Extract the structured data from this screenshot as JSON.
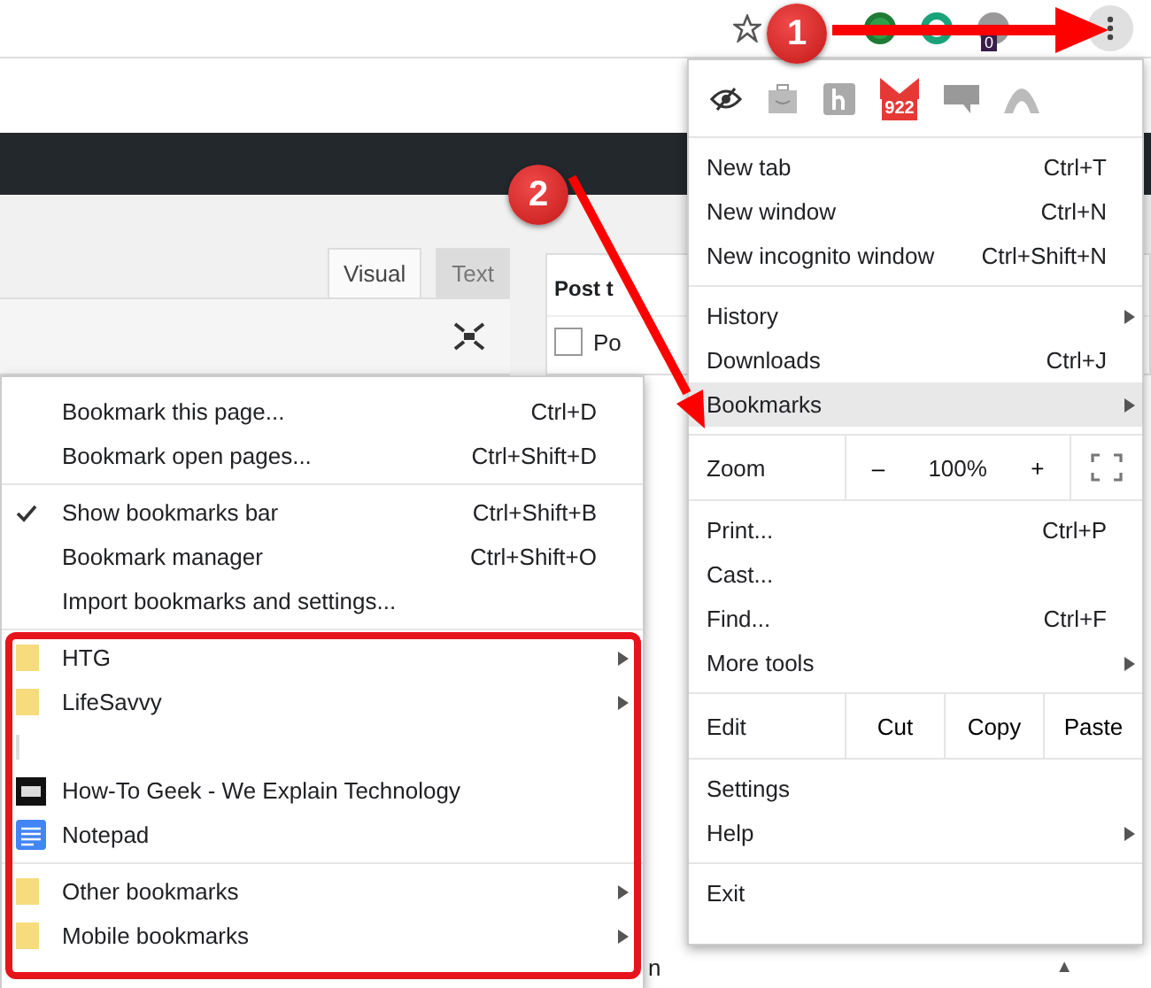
{
  "toolbar": {
    "extension_badge": "0"
  },
  "editor": {
    "tabs": [
      {
        "label": "Visual",
        "selected": true
      },
      {
        "label": "Text",
        "selected": false
      }
    ]
  },
  "side_panel": {
    "title": "Post t",
    "checkbox_label": "Po",
    "checked": false
  },
  "page_footer": {
    "text": "n",
    "arrow": "▲"
  },
  "chrome_menu": {
    "extension_badge": "922",
    "sections": [
      {
        "kind": "items",
        "items": [
          {
            "label": "New tab",
            "shortcut": "Ctrl+T",
            "submenu": false,
            "selected": false
          },
          {
            "label": "New window",
            "shortcut": "Ctrl+N",
            "submenu": false,
            "selected": false
          },
          {
            "label": "New incognito window",
            "shortcut": "Ctrl+Shift+N",
            "submenu": false,
            "selected": false
          }
        ]
      },
      {
        "kind": "items",
        "items": [
          {
            "label": "History",
            "submenu": true,
            "selected": false
          },
          {
            "label": "Downloads",
            "shortcut": "Ctrl+J",
            "submenu": false,
            "selected": false
          },
          {
            "label": "Bookmarks",
            "submenu": true,
            "selected": true
          }
        ]
      },
      {
        "kind": "zoom",
        "label": "Zoom",
        "minus": "–",
        "value": "100%",
        "plus": "+"
      },
      {
        "kind": "items",
        "items": [
          {
            "label": "Print...",
            "shortcut": "Ctrl+P",
            "submenu": false,
            "selected": false
          },
          {
            "label": "Cast...",
            "submenu": false,
            "selected": false
          },
          {
            "label": "Find...",
            "shortcut": "Ctrl+F",
            "submenu": false,
            "selected": false
          },
          {
            "label": "More tools",
            "submenu": true,
            "selected": false
          }
        ]
      },
      {
        "kind": "edit",
        "label": "Edit",
        "buttons": [
          "Cut",
          "Copy",
          "Paste"
        ]
      },
      {
        "kind": "items",
        "items": [
          {
            "label": "Settings",
            "submenu": false,
            "selected": false
          },
          {
            "label": "Help",
            "submenu": true,
            "selected": false
          }
        ]
      },
      {
        "kind": "items",
        "items": [
          {
            "label": "Exit",
            "submenu": false,
            "selected": false
          }
        ]
      }
    ]
  },
  "bookmarks_menu": {
    "sections": [
      {
        "items": [
          {
            "kind": "action",
            "label": "Bookmark this page...",
            "shortcut": "Ctrl+D"
          },
          {
            "kind": "action",
            "label": "Bookmark open pages...",
            "shortcut": "Ctrl+Shift+D"
          }
        ]
      },
      {
        "items": [
          {
            "kind": "action",
            "label": "Show bookmarks bar",
            "shortcut": "Ctrl+Shift+B",
            "checked": true
          },
          {
            "kind": "action",
            "label": "Bookmark manager",
            "shortcut": "Ctrl+Shift+O",
            "checked": false
          },
          {
            "kind": "action",
            "label": "Import bookmarks and settings...",
            "checked": false
          }
        ]
      },
      {
        "items": [
          {
            "kind": "folder",
            "label": "HTG"
          },
          {
            "kind": "folder",
            "label": "LifeSavvy"
          },
          {
            "kind": "blank"
          },
          {
            "kind": "site",
            "label": "How-To Geek - We Explain Technology"
          },
          {
            "kind": "document",
            "label": "Notepad"
          }
        ]
      },
      {
        "items": [
          {
            "kind": "folder",
            "label": "Other bookmarks"
          },
          {
            "kind": "folder",
            "label": "Mobile bookmarks"
          }
        ]
      }
    ]
  },
  "annotations": [
    {
      "number": "1"
    },
    {
      "number": "2"
    }
  ]
}
